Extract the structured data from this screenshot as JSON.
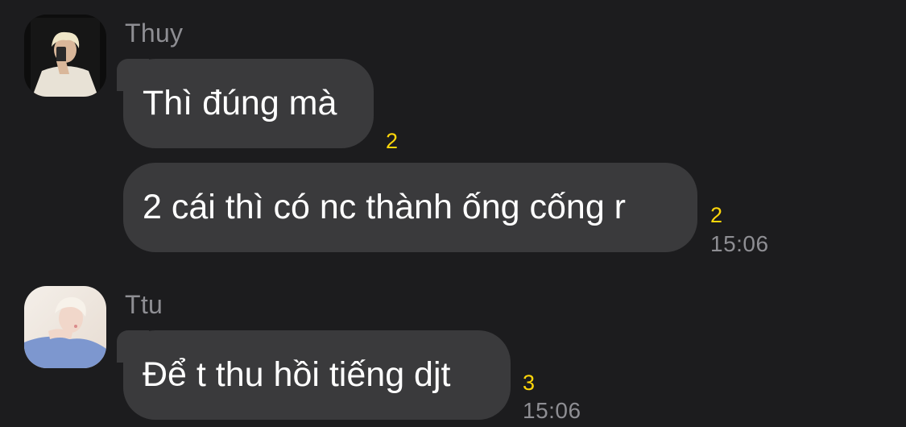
{
  "messages": [
    {
      "sender": "Thuy",
      "avatar_icon": "avatar-thuy-photo",
      "bubbles": [
        {
          "text": "Thì đúng mà",
          "reaction_count": "2"
        },
        {
          "text": "2 cái thì có nc thành ống cống r",
          "reaction_count": "2",
          "time": "15:06"
        }
      ]
    },
    {
      "sender": "Ttu",
      "avatar_icon": "avatar-ttu-photo",
      "bubbles": [
        {
          "text": "Để t thu hồi tiếng djt",
          "reaction_count": "3",
          "time": "15:06"
        }
      ]
    }
  ],
  "colors": {
    "background": "#1c1c1e",
    "bubble": "#3a3a3c",
    "reaction": "#ffd60a",
    "meta_text": "#8e8e93"
  }
}
